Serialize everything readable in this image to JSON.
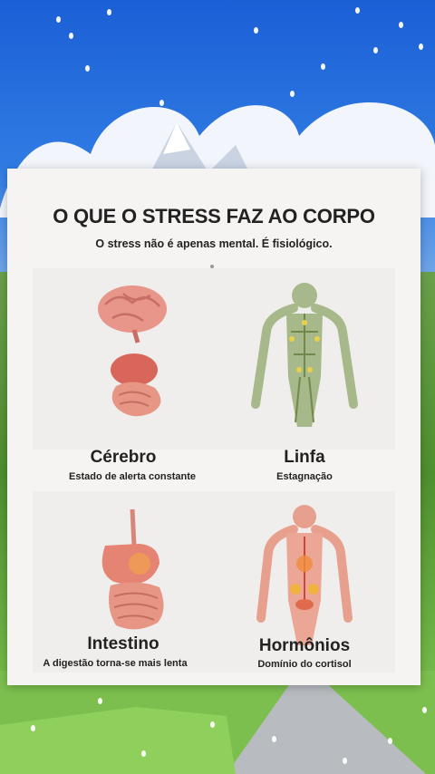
{
  "card": {
    "title": "O QUE O STRESS FAZ AO CORPO",
    "subtitle": "O stress não é apenas mental. É fisiológico."
  },
  "items": [
    {
      "label": "Cérebro",
      "description": "Estado de alerta constante",
      "icon": "brain-gut-icon"
    },
    {
      "label": "Linfa",
      "description": "Estagnação",
      "icon": "lymph-body-icon"
    },
    {
      "label": "Intestino",
      "description": "A digestão torna-se mais lenta",
      "icon": "intestine-icon"
    },
    {
      "label": "Hormônios",
      "description": "Domínio do cortisol",
      "icon": "hormone-body-icon"
    }
  ],
  "colors": {
    "card_bg": "#f6f4f2",
    "text": "#222222",
    "organ": "#e07a63",
    "lymph": "#8fa86a"
  }
}
